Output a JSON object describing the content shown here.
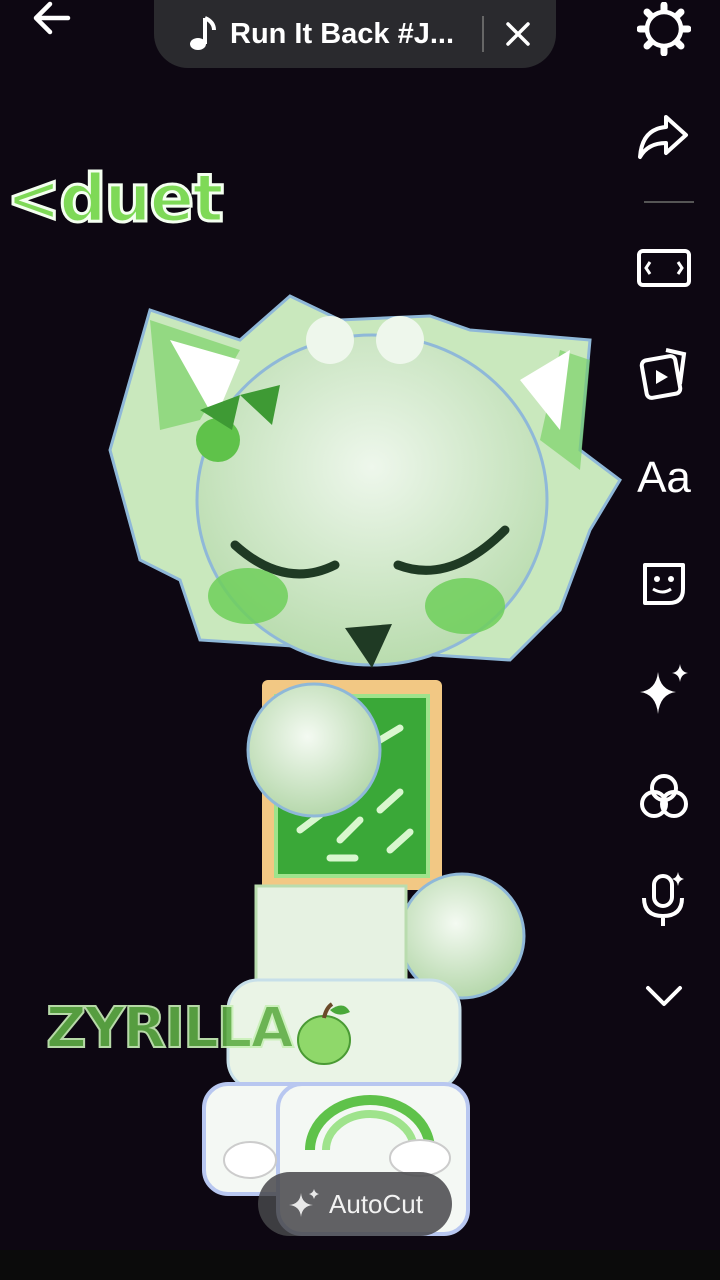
{
  "header": {
    "sound_title": "Run It Back #J...",
    "back_icon": "arrow-left-icon",
    "music_icon": "music-note-icon",
    "close_icon": "close-icon"
  },
  "overlay_text": {
    "duet": "<duet",
    "watermark": "ZYRILLA"
  },
  "rail": {
    "tools": [
      {
        "name": "settings",
        "icon": "gear-icon"
      },
      {
        "name": "share",
        "icon": "share-arrow-icon"
      },
      {
        "name": "crop",
        "icon": "aspect-ratio-icon"
      },
      {
        "name": "templates",
        "icon": "video-cards-icon"
      },
      {
        "name": "text",
        "label": "Aa"
      },
      {
        "name": "stickers",
        "icon": "sticker-icon"
      },
      {
        "name": "effects",
        "icon": "sparkle-icon"
      },
      {
        "name": "filters",
        "icon": "filter-circles-icon"
      },
      {
        "name": "voice",
        "icon": "microphone-sparkle-icon"
      },
      {
        "name": "more",
        "icon": "chevron-down-icon"
      }
    ]
  },
  "autocut": {
    "label": "AutoCut",
    "icon": "sparkle-icon"
  },
  "colors": {
    "background": "#0d0712",
    "duet_green": "#7ed957",
    "pill_bg": "#2a2a2e",
    "character_green": "#6fcf5a"
  }
}
